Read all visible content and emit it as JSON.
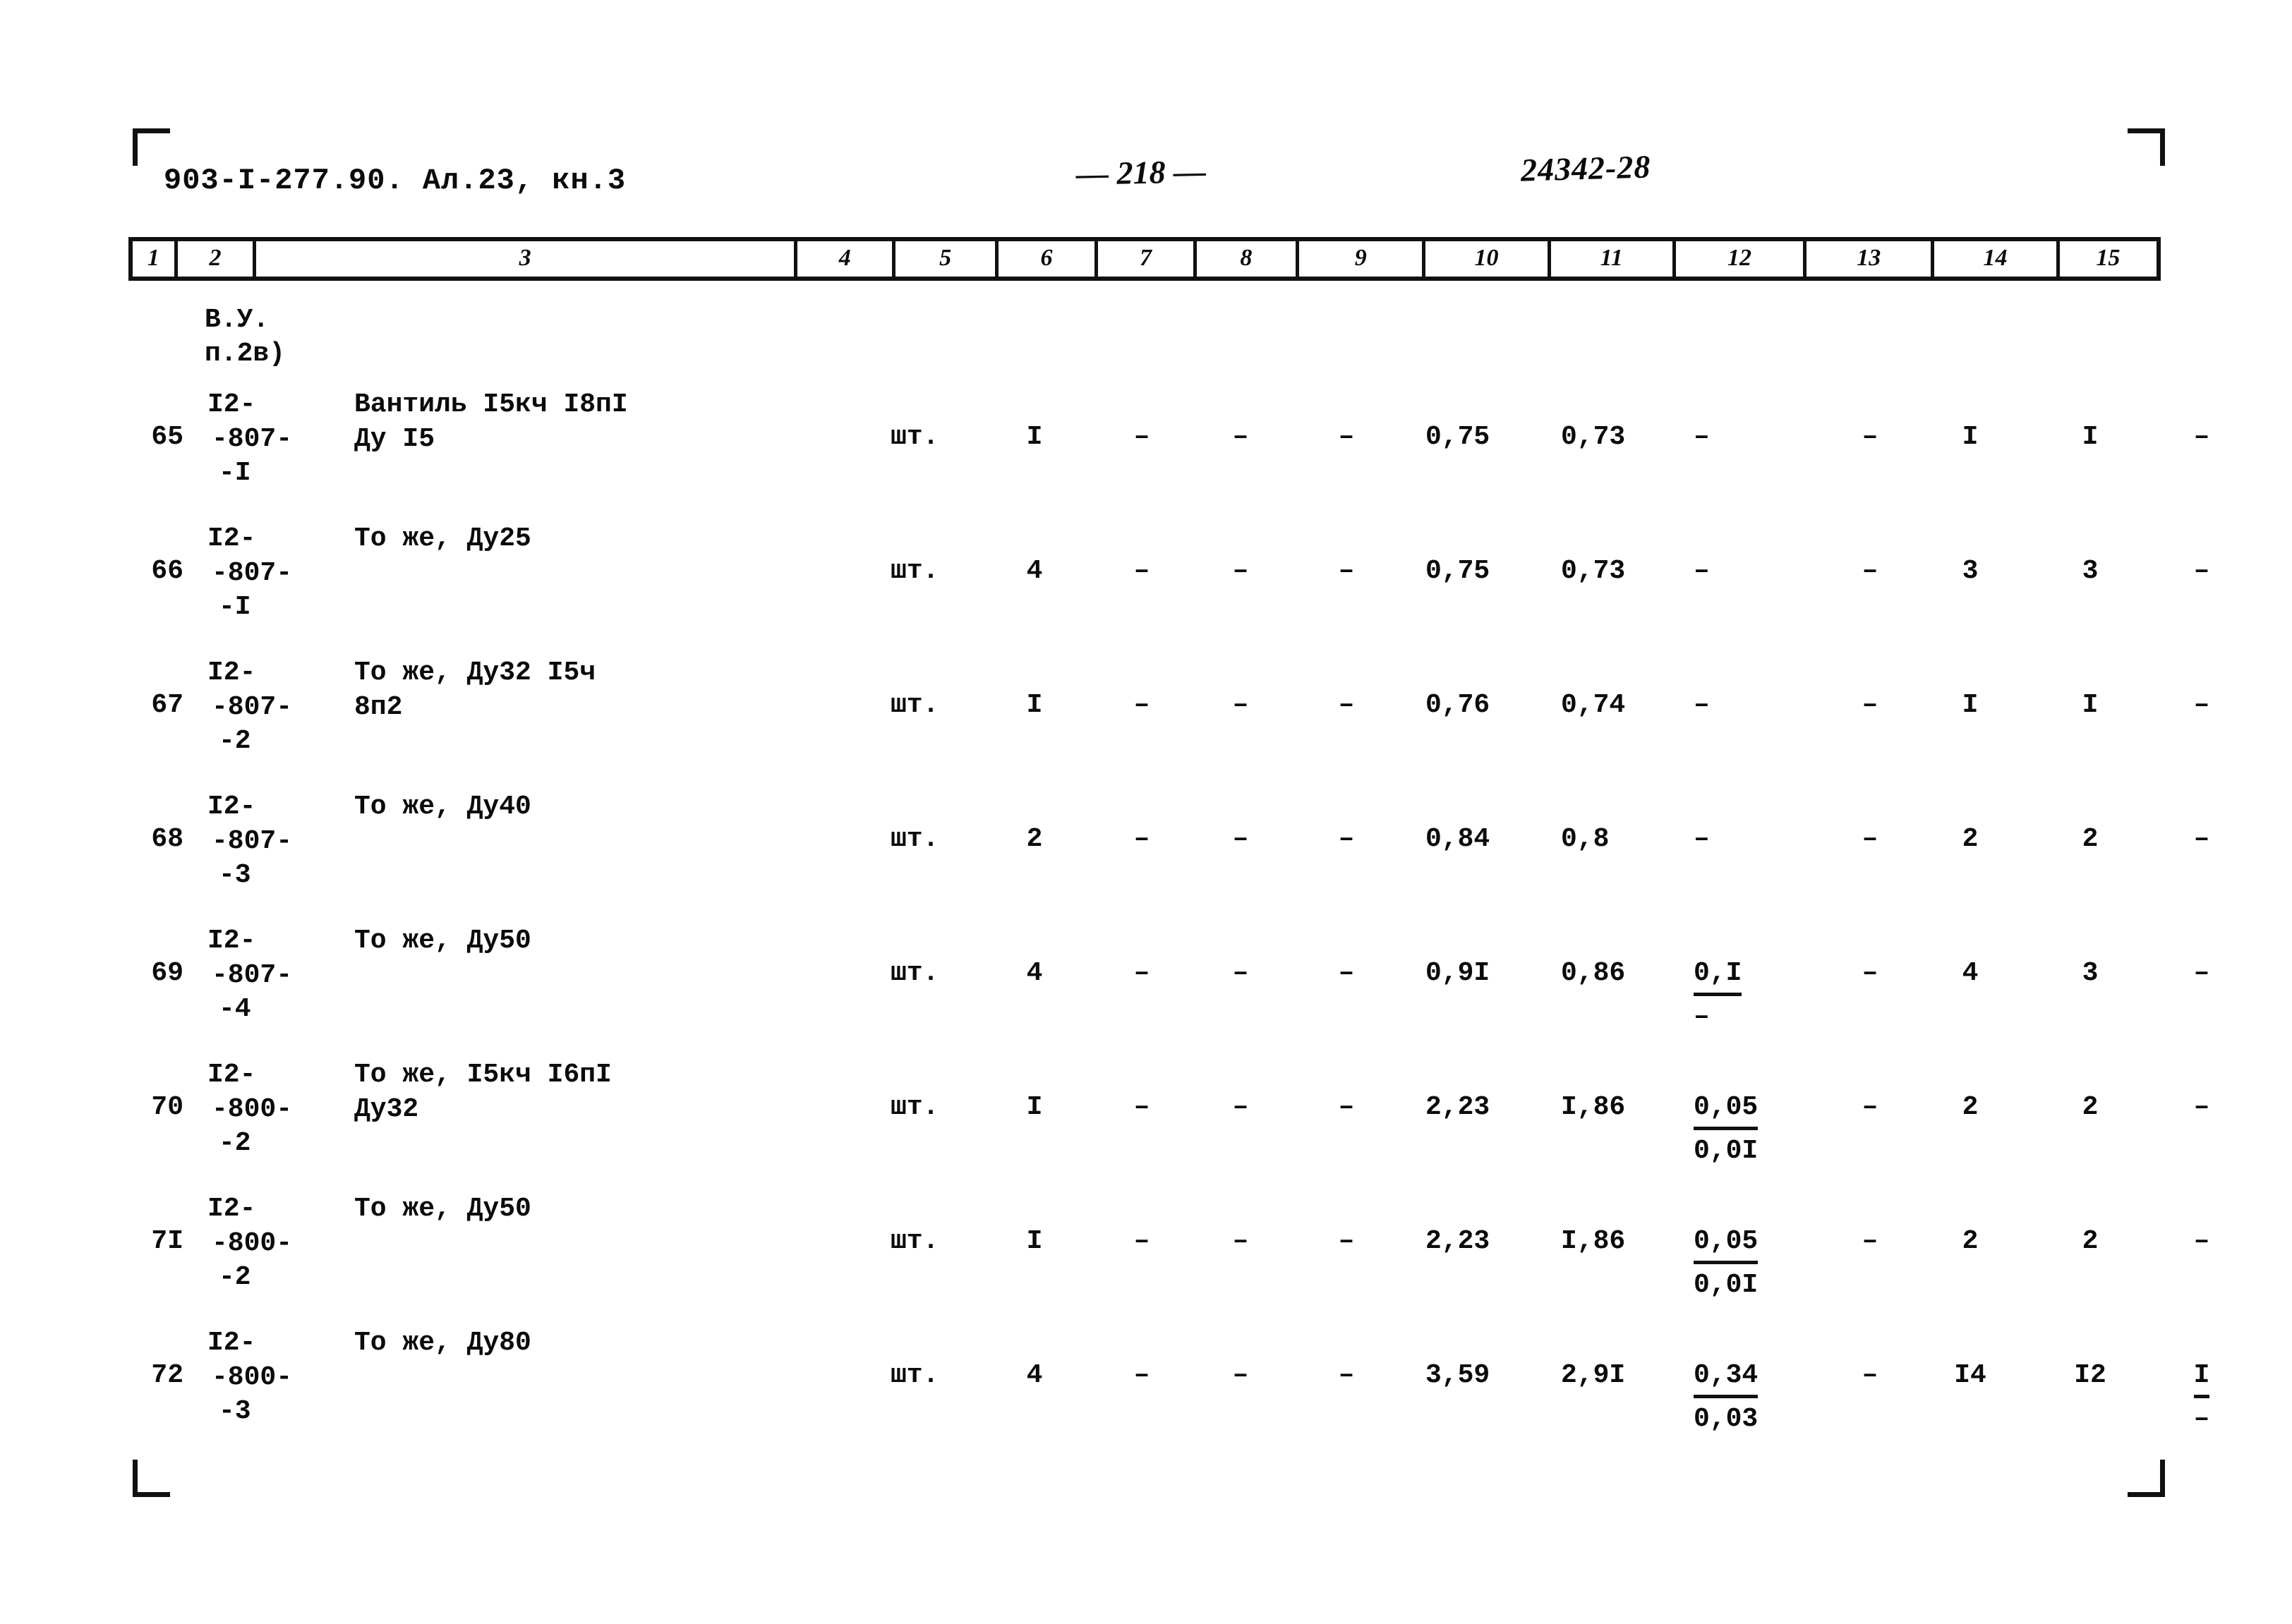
{
  "header": {
    "doc_code": "903-I-277.90. Ал.23, кн.3",
    "page_number": "— 218 —",
    "stamp": "24342-28"
  },
  "column_ruler": [
    "1",
    "2",
    "3",
    "4",
    "5",
    "6",
    "7",
    "8",
    "9",
    "10",
    "11",
    "12",
    "13",
    "14",
    "15"
  ],
  "note": {
    "line1": "В.У.",
    "line2": "п.2в)"
  },
  "rows": [
    {
      "num": "65",
      "code": [
        "I2-",
        "-807-",
        "-I"
      ],
      "name": [
        "Вантиль I5кч I8пI",
        "Ду I5"
      ],
      "unit": "шт.",
      "c5": "I",
      "c6": "–",
      "c7": "–",
      "c8": "–",
      "c9": "0,75",
      "c10": "0,73",
      "c11_top": "–",
      "c11_bot": "",
      "c12": "–",
      "c13": "I",
      "c14": "I",
      "c15_top": "–",
      "c15_bot": ""
    },
    {
      "num": "66",
      "code": [
        "I2-",
        "-807-",
        "-I"
      ],
      "name": [
        "То же, Ду25"
      ],
      "unit": "шт.",
      "c5": "4",
      "c6": "–",
      "c7": "–",
      "c8": "–",
      "c9": "0,75",
      "c10": "0,73",
      "c11_top": "–",
      "c11_bot": "",
      "c12": "–",
      "c13": "3",
      "c14": "3",
      "c15_top": "–",
      "c15_bot": ""
    },
    {
      "num": "67",
      "code": [
        "I2-",
        "-807-",
        "-2"
      ],
      "name": [
        "То же, Ду32 I5ч",
        "8п2"
      ],
      "unit": "шт.",
      "c5": "I",
      "c6": "–",
      "c7": "–",
      "c8": "–",
      "c9": "0,76",
      "c10": "0,74",
      "c11_top": "–",
      "c11_bot": "",
      "c12": "–",
      "c13": "I",
      "c14": "I",
      "c15_top": "–",
      "c15_bot": ""
    },
    {
      "num": "68",
      "code": [
        "I2-",
        "-807-",
        "-3"
      ],
      "name": [
        "То же, Ду40"
      ],
      "unit": "шт.",
      "c5": "2",
      "c6": "–",
      "c7": "–",
      "c8": "–",
      "c9": "0,84",
      "c10": "0,8",
      "c11_top": "–",
      "c11_bot": "",
      "c12": "–",
      "c13": "2",
      "c14": "2",
      "c15_top": "–",
      "c15_bot": ""
    },
    {
      "num": "69",
      "code": [
        "I2-",
        "-807-",
        "-4"
      ],
      "name": [
        "То же, Ду50"
      ],
      "unit": "шт.",
      "c5": "4",
      "c6": "–",
      "c7": "–",
      "c8": "–",
      "c9": "0,9I",
      "c10": "0,86",
      "c11_top": "0,I",
      "c11_bot": "–",
      "c12": "–",
      "c13": "4",
      "c14": "3",
      "c15_top": "–",
      "c15_bot": ""
    },
    {
      "num": "70",
      "code": [
        "I2-",
        "-800-",
        "-2"
      ],
      "name": [
        "То же, I5кч I6пI",
        "Ду32"
      ],
      "unit": "шт.",
      "c5": "I",
      "c6": "–",
      "c7": "–",
      "c8": "–",
      "c9": "2,23",
      "c10": "I,86",
      "c11_top": "0,05",
      "c11_bot": "0,0I",
      "c12": "–",
      "c13": "2",
      "c14": "2",
      "c15_top": "–",
      "c15_bot": ""
    },
    {
      "num": "7I",
      "code": [
        "I2-",
        "-800-",
        "-2"
      ],
      "name": [
        "То же, Ду50"
      ],
      "unit": "шт.",
      "c5": "I",
      "c6": "–",
      "c7": "–",
      "c8": "–",
      "c9": "2,23",
      "c10": "I,86",
      "c11_top": "0,05",
      "c11_bot": "0,0I",
      "c12": "–",
      "c13": "2",
      "c14": "2",
      "c15_top": "–",
      "c15_bot": ""
    },
    {
      "num": "72",
      "code": [
        "I2-",
        "-800-",
        "-3"
      ],
      "name": [
        "То же, Ду80"
      ],
      "unit": "шт.",
      "c5": "4",
      "c6": "–",
      "c7": "–",
      "c8": "–",
      "c9": "3,59",
      "c10": "2,9I",
      "c11_top": "0,34",
      "c11_bot": "0,03",
      "c12": "–",
      "c13": "I4",
      "c14": "I2",
      "c15_top": "I",
      "c15_bot": "–"
    }
  ]
}
